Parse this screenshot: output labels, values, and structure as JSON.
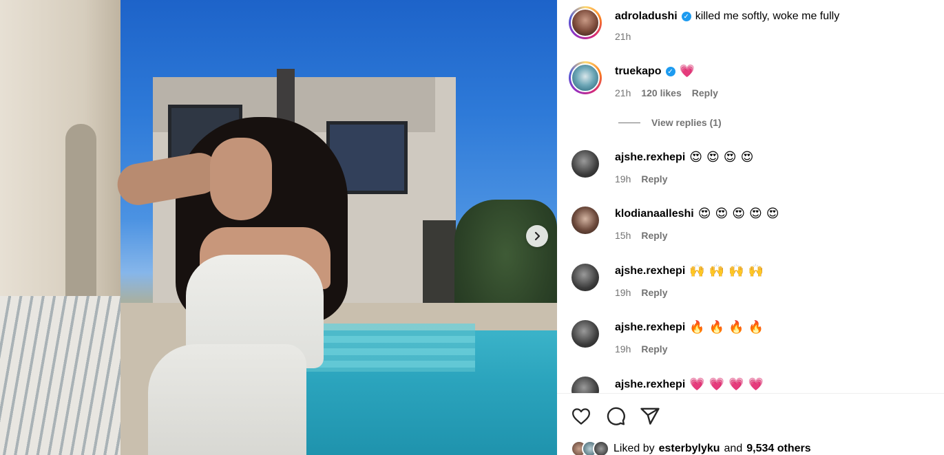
{
  "carousel": {
    "next_icon": "chevron-right-icon"
  },
  "caption": {
    "username": "adroladushi",
    "text": "killed me softly, woke me fully",
    "time": "21h",
    "verified": true
  },
  "comments": [
    {
      "username": "truekapo",
      "verified": true,
      "text": "💗",
      "time": "21h",
      "likes": "120 likes",
      "reply": "Reply",
      "view_replies": "View replies (1)"
    },
    {
      "username": "ajshe.rexhepi",
      "text": "😍😍😍😍",
      "time": "19h",
      "reply": "Reply"
    },
    {
      "username": "klodianaalleshi",
      "text": "😍😍😍😍😍",
      "time": "15h",
      "reply": "Reply"
    },
    {
      "username": "ajshe.rexhepi",
      "text": "🙌🙌🙌🙌",
      "time": "19h",
      "reply": "Reply"
    },
    {
      "username": "ajshe.rexhepi",
      "text": "🔥🔥🔥🔥",
      "time": "19h",
      "reply": "Reply"
    },
    {
      "username": "ajshe.rexhepi",
      "text": "💗💗💗💗"
    }
  ],
  "actions": {
    "like": "heart-icon",
    "comment": "comment-bubble-icon",
    "share": "paper-plane-icon"
  },
  "liked_by": {
    "prefix": "Liked by",
    "user": "esterbylyku",
    "middle": "and",
    "others": "9,534 others"
  },
  "colors": {
    "verified": "#1d9bf0",
    "meta": "#737373",
    "heart_pink": "#ff3e7f"
  }
}
